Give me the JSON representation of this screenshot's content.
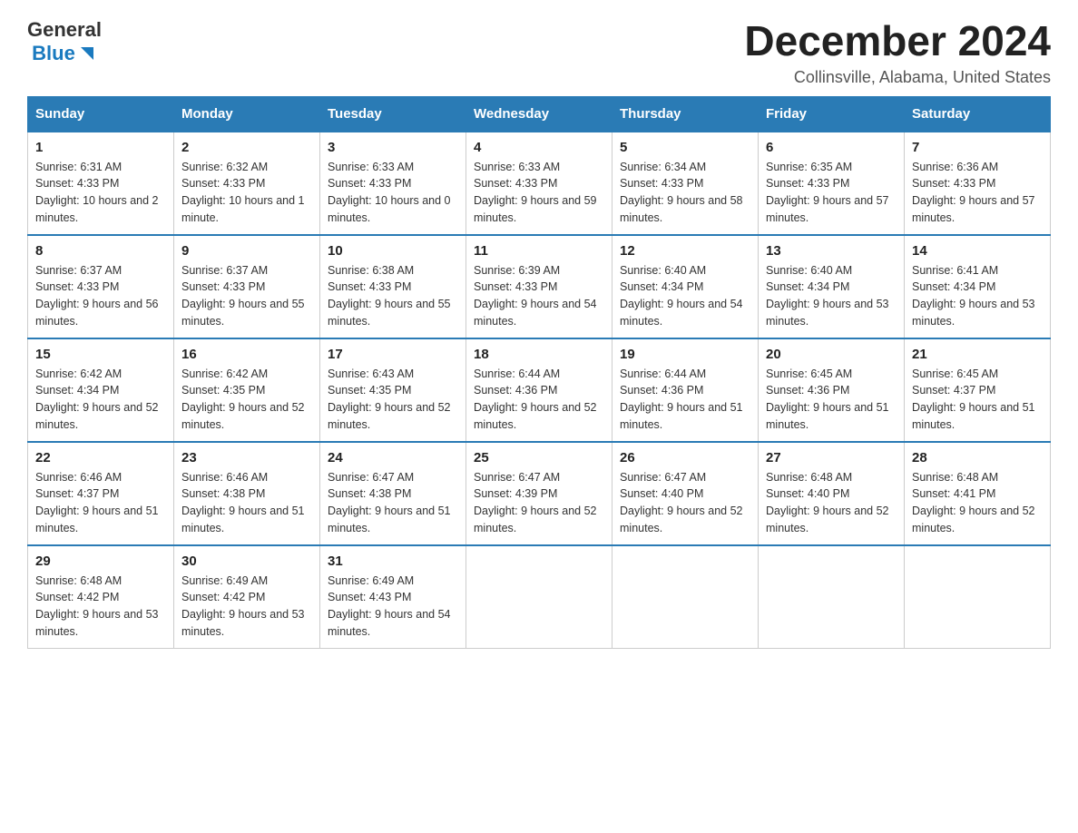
{
  "header": {
    "logo_text_general": "General",
    "logo_text_blue": "Blue",
    "title": "December 2024",
    "subtitle": "Collinsville, Alabama, United States"
  },
  "weekdays": [
    "Sunday",
    "Monday",
    "Tuesday",
    "Wednesday",
    "Thursday",
    "Friday",
    "Saturday"
  ],
  "weeks": [
    [
      {
        "day": "1",
        "sunrise": "6:31 AM",
        "sunset": "4:33 PM",
        "daylight": "10 hours and 2 minutes."
      },
      {
        "day": "2",
        "sunrise": "6:32 AM",
        "sunset": "4:33 PM",
        "daylight": "10 hours and 1 minute."
      },
      {
        "day": "3",
        "sunrise": "6:33 AM",
        "sunset": "4:33 PM",
        "daylight": "10 hours and 0 minutes."
      },
      {
        "day": "4",
        "sunrise": "6:33 AM",
        "sunset": "4:33 PM",
        "daylight": "9 hours and 59 minutes."
      },
      {
        "day": "5",
        "sunrise": "6:34 AM",
        "sunset": "4:33 PM",
        "daylight": "9 hours and 58 minutes."
      },
      {
        "day": "6",
        "sunrise": "6:35 AM",
        "sunset": "4:33 PM",
        "daylight": "9 hours and 57 minutes."
      },
      {
        "day": "7",
        "sunrise": "6:36 AM",
        "sunset": "4:33 PM",
        "daylight": "9 hours and 57 minutes."
      }
    ],
    [
      {
        "day": "8",
        "sunrise": "6:37 AM",
        "sunset": "4:33 PM",
        "daylight": "9 hours and 56 minutes."
      },
      {
        "day": "9",
        "sunrise": "6:37 AM",
        "sunset": "4:33 PM",
        "daylight": "9 hours and 55 minutes."
      },
      {
        "day": "10",
        "sunrise": "6:38 AM",
        "sunset": "4:33 PM",
        "daylight": "9 hours and 55 minutes."
      },
      {
        "day": "11",
        "sunrise": "6:39 AM",
        "sunset": "4:33 PM",
        "daylight": "9 hours and 54 minutes."
      },
      {
        "day": "12",
        "sunrise": "6:40 AM",
        "sunset": "4:34 PM",
        "daylight": "9 hours and 54 minutes."
      },
      {
        "day": "13",
        "sunrise": "6:40 AM",
        "sunset": "4:34 PM",
        "daylight": "9 hours and 53 minutes."
      },
      {
        "day": "14",
        "sunrise": "6:41 AM",
        "sunset": "4:34 PM",
        "daylight": "9 hours and 53 minutes."
      }
    ],
    [
      {
        "day": "15",
        "sunrise": "6:42 AM",
        "sunset": "4:34 PM",
        "daylight": "9 hours and 52 minutes."
      },
      {
        "day": "16",
        "sunrise": "6:42 AM",
        "sunset": "4:35 PM",
        "daylight": "9 hours and 52 minutes."
      },
      {
        "day": "17",
        "sunrise": "6:43 AM",
        "sunset": "4:35 PM",
        "daylight": "9 hours and 52 minutes."
      },
      {
        "day": "18",
        "sunrise": "6:44 AM",
        "sunset": "4:36 PM",
        "daylight": "9 hours and 52 minutes."
      },
      {
        "day": "19",
        "sunrise": "6:44 AM",
        "sunset": "4:36 PM",
        "daylight": "9 hours and 51 minutes."
      },
      {
        "day": "20",
        "sunrise": "6:45 AM",
        "sunset": "4:36 PM",
        "daylight": "9 hours and 51 minutes."
      },
      {
        "day": "21",
        "sunrise": "6:45 AM",
        "sunset": "4:37 PM",
        "daylight": "9 hours and 51 minutes."
      }
    ],
    [
      {
        "day": "22",
        "sunrise": "6:46 AM",
        "sunset": "4:37 PM",
        "daylight": "9 hours and 51 minutes."
      },
      {
        "day": "23",
        "sunrise": "6:46 AM",
        "sunset": "4:38 PM",
        "daylight": "9 hours and 51 minutes."
      },
      {
        "day": "24",
        "sunrise": "6:47 AM",
        "sunset": "4:38 PM",
        "daylight": "9 hours and 51 minutes."
      },
      {
        "day": "25",
        "sunrise": "6:47 AM",
        "sunset": "4:39 PM",
        "daylight": "9 hours and 52 minutes."
      },
      {
        "day": "26",
        "sunrise": "6:47 AM",
        "sunset": "4:40 PM",
        "daylight": "9 hours and 52 minutes."
      },
      {
        "day": "27",
        "sunrise": "6:48 AM",
        "sunset": "4:40 PM",
        "daylight": "9 hours and 52 minutes."
      },
      {
        "day": "28",
        "sunrise": "6:48 AM",
        "sunset": "4:41 PM",
        "daylight": "9 hours and 52 minutes."
      }
    ],
    [
      {
        "day": "29",
        "sunrise": "6:48 AM",
        "sunset": "4:42 PM",
        "daylight": "9 hours and 53 minutes."
      },
      {
        "day": "30",
        "sunrise": "6:49 AM",
        "sunset": "4:42 PM",
        "daylight": "9 hours and 53 minutes."
      },
      {
        "day": "31",
        "sunrise": "6:49 AM",
        "sunset": "4:43 PM",
        "daylight": "9 hours and 54 minutes."
      },
      null,
      null,
      null,
      null
    ]
  ]
}
